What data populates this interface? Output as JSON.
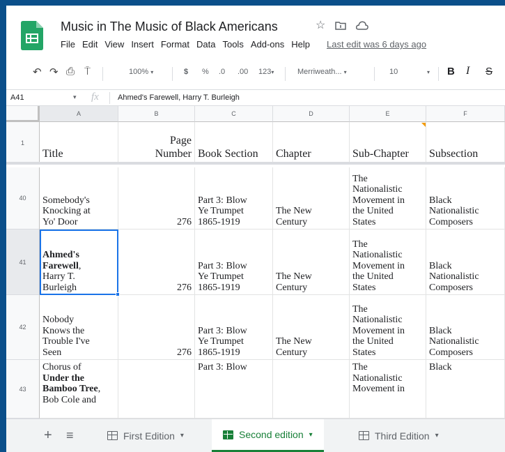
{
  "app": {
    "title": "Music in The Music of Black Americans",
    "menus": [
      "File",
      "Edit",
      "View",
      "Insert",
      "Format",
      "Data",
      "Tools",
      "Add-ons",
      "Help"
    ],
    "last_edit": "Last edit was 6 days ago"
  },
  "toolbar": {
    "zoom": "100%",
    "currency": "$",
    "percent": "%",
    "dec_decrease": ".0",
    "dec_increase": ".00",
    "more_formats": "123",
    "font": "Merriweath...",
    "font_size": "10",
    "bold": "B",
    "italic": "I",
    "strike": "S"
  },
  "formula_bar": {
    "cell_ref": "A41",
    "fx": "fx",
    "content": "Ahmed's Farewell, Harry T. Burleigh"
  },
  "columns": [
    "A",
    "B",
    "C",
    "D",
    "E",
    "F"
  ],
  "header_row": {
    "row_num": "1",
    "cells": [
      [
        "Title"
      ],
      [
        "Page",
        "Number"
      ],
      [
        "Book Section"
      ],
      [
        "Chapter"
      ],
      [
        "Sub-Chapter"
      ],
      [
        "Subsection"
      ]
    ]
  },
  "rows": [
    {
      "row_num": "40",
      "cells": [
        [
          [
            "Somebody's"
          ],
          [
            "Knocking at"
          ],
          [
            "Yo' Door"
          ]
        ],
        [
          [
            "276"
          ]
        ],
        [
          [
            "Part 3: Blow"
          ],
          [
            "Ye Trumpet"
          ],
          [
            "1865-1919"
          ]
        ],
        [
          [
            "The New"
          ],
          [
            "Century"
          ]
        ],
        [
          [
            "The"
          ],
          [
            "Nationalistic"
          ],
          [
            "Movement in"
          ],
          [
            "the United"
          ],
          [
            "States"
          ]
        ],
        [
          [
            "Black"
          ],
          [
            "Nationalistic"
          ],
          [
            "Composers"
          ]
        ]
      ]
    },
    {
      "row_num": "41",
      "cells": [
        [
          [
            "Ahmed's"
          ],
          [
            "Farewell",
            ","
          ],
          [
            "Harry T."
          ],
          [
            "Burleigh"
          ]
        ],
        [
          [
            "276"
          ]
        ],
        [
          [
            "Part 3: Blow"
          ],
          [
            "Ye Trumpet"
          ],
          [
            "1865-1919"
          ]
        ],
        [
          [
            "The New"
          ],
          [
            "Century"
          ]
        ],
        [
          [
            "The"
          ],
          [
            "Nationalistic"
          ],
          [
            "Movement in"
          ],
          [
            "the United"
          ],
          [
            "States"
          ]
        ],
        [
          [
            "Black"
          ],
          [
            "Nationalistic"
          ],
          [
            "Composers"
          ]
        ]
      ]
    },
    {
      "row_num": "42",
      "cells": [
        [
          [
            "Nobody"
          ],
          [
            "Knows the"
          ],
          [
            "Trouble I've"
          ],
          [
            "Seen"
          ]
        ],
        [
          [
            "276"
          ]
        ],
        [
          [
            "Part 3: Blow"
          ],
          [
            "Ye Trumpet"
          ],
          [
            "1865-1919"
          ]
        ],
        [
          [
            "The New"
          ],
          [
            "Century"
          ]
        ],
        [
          [
            "The"
          ],
          [
            "Nationalistic"
          ],
          [
            "Movement in"
          ],
          [
            "the United"
          ],
          [
            "States"
          ]
        ],
        [
          [
            "Black"
          ],
          [
            "Nationalistic"
          ],
          [
            "Composers"
          ]
        ]
      ]
    },
    {
      "row_num": "43",
      "cells": [
        [
          [
            "Chorus of"
          ],
          [
            "Under the"
          ],
          [
            "Bamboo Tree",
            ","
          ],
          [
            "Bob Cole and"
          ]
        ],
        [
          [
            ""
          ]
        ],
        [
          [
            "Part 3: Blow"
          ]
        ],
        [
          [
            ""
          ]
        ],
        [
          [
            "The"
          ],
          [
            "Nationalistic"
          ],
          [
            "Movement in"
          ]
        ],
        [
          [
            "Black"
          ]
        ]
      ]
    }
  ],
  "sheet_tabs": {
    "add": "+",
    "list": "≡",
    "tabs": [
      "First Edition",
      "Second edition",
      "Third Edition"
    ],
    "active": "Second edition"
  },
  "colors": {
    "frame": "#0b4f8a",
    "sheets_green": "#188038",
    "selection": "#1a73e8"
  }
}
